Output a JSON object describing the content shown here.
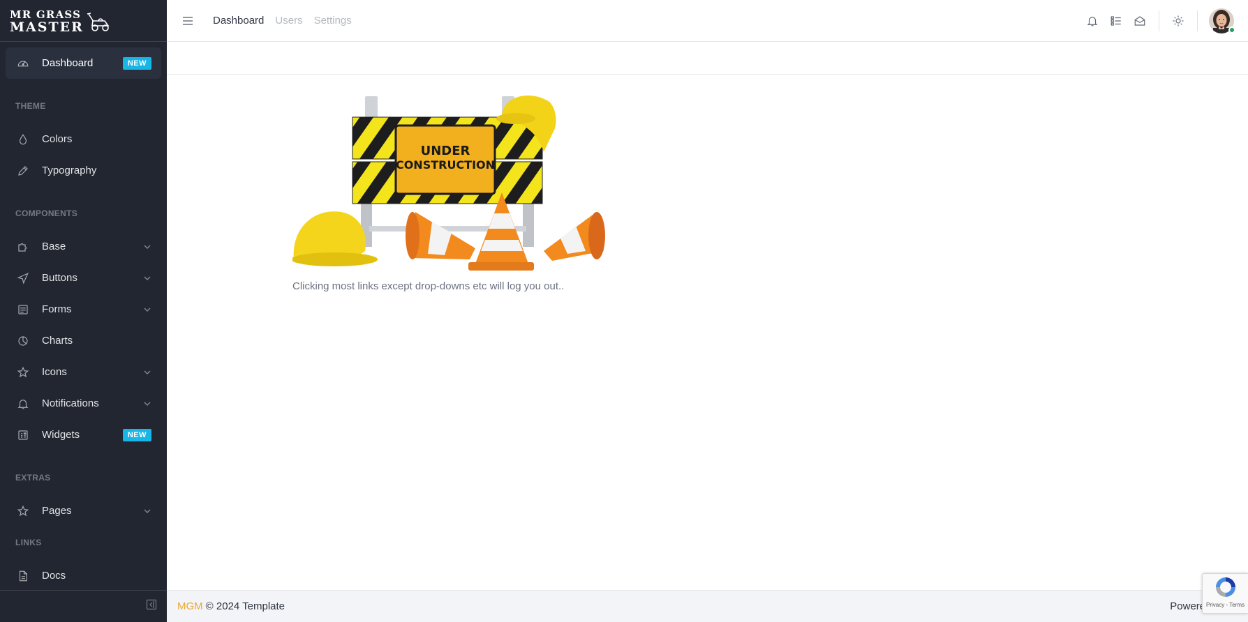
{
  "brand": {
    "line1": "MR GRASS",
    "line2": "MASTER"
  },
  "sidebar": {
    "dashboard": {
      "label": "Dashboard",
      "badge": "NEW",
      "icon": "speedometer-icon"
    },
    "sections": [
      {
        "title": "THEME"
      },
      {
        "title": "COMPONENTS"
      },
      {
        "title": "EXTRAS"
      },
      {
        "title": "LINKS"
      }
    ],
    "items": {
      "colors": {
        "label": "Colors",
        "icon": "drop-icon"
      },
      "typography": {
        "label": "Typography",
        "icon": "pencil-icon"
      },
      "base": {
        "label": "Base",
        "icon": "puzzle-icon"
      },
      "buttons": {
        "label": "Buttons",
        "icon": "cursor-icon"
      },
      "forms": {
        "label": "Forms",
        "icon": "notes-icon"
      },
      "charts": {
        "label": "Charts",
        "icon": "chart-pie-icon"
      },
      "icons": {
        "label": "Icons",
        "icon": "star-icon"
      },
      "notifications": {
        "label": "Notifications",
        "icon": "bell-icon"
      },
      "widgets": {
        "label": "Widgets",
        "badge": "NEW",
        "icon": "calculator-icon"
      },
      "pages": {
        "label": "Pages",
        "icon": "star-icon"
      },
      "docs": {
        "label": "Docs",
        "icon": "description-icon"
      }
    }
  },
  "header": {
    "nav": [
      {
        "label": "Dashboard"
      },
      {
        "label": "Users"
      },
      {
        "label": "Settings"
      }
    ]
  },
  "main": {
    "image_text_line1": "UNDER",
    "image_text_line2": "CONSTRUCTION",
    "caption": "Clicking most links except drop-downs etc will log you out.."
  },
  "footer": {
    "brand": "MGM",
    "copyright": "© 2024 Template",
    "powered": "Powered b"
  },
  "recaptcha": {
    "links": "Privacy - Terms"
  },
  "colors": {
    "sidebar_bg": "#212631",
    "badge": "#18b6e6",
    "footer_brand": "#e8a935"
  }
}
